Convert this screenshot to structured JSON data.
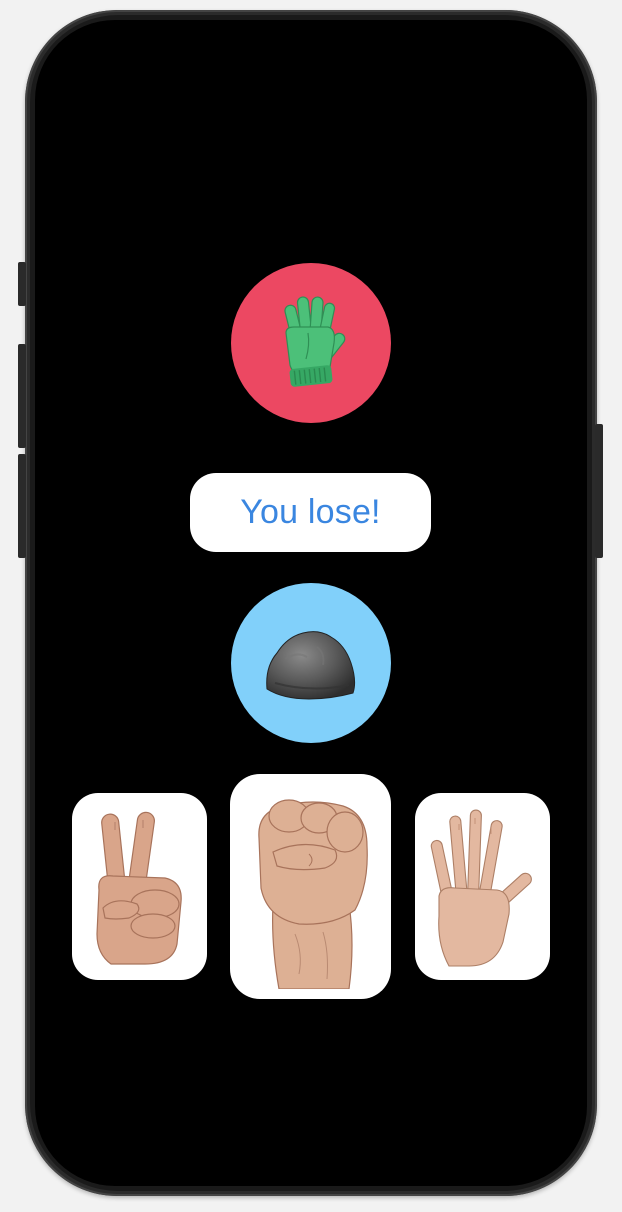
{
  "game": {
    "opponent_choice": {
      "icon": "glove-icon",
      "background_color": "#ec4862"
    },
    "result_text": "You lose!",
    "result_text_color": "#3a86e0",
    "player_choice": {
      "icon": "rock-icon",
      "background_color": "#81d0fa"
    },
    "options": [
      {
        "icon": "scissors-hand-icon"
      },
      {
        "icon": "rock-fist-hand-icon"
      },
      {
        "icon": "paper-open-hand-icon"
      }
    ]
  }
}
